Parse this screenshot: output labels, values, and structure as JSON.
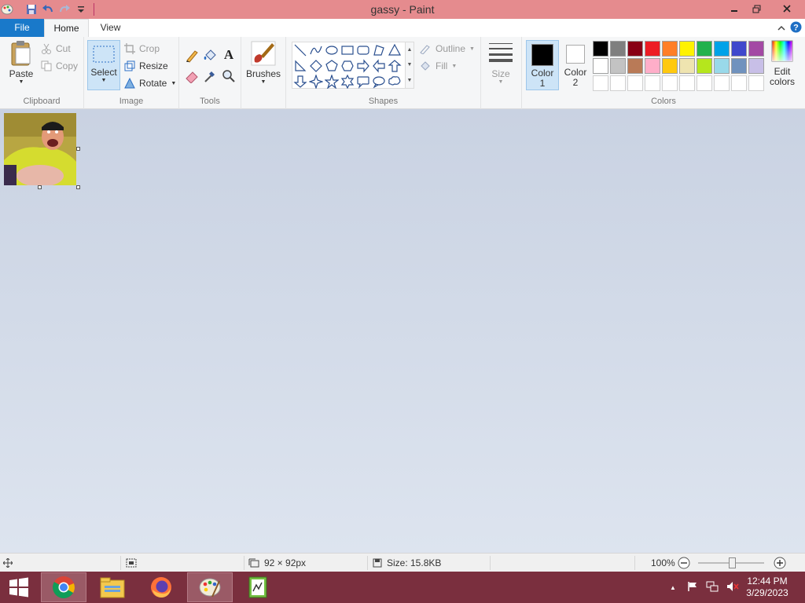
{
  "window": {
    "title": "gassy - Paint"
  },
  "qat": {
    "icons": [
      "paint-app-icon",
      "save-icon",
      "undo-icon",
      "redo-icon",
      "customize-qat-icon"
    ]
  },
  "tabs": {
    "file": "File",
    "home": "Home",
    "view": "View"
  },
  "ribbon": {
    "clipboard": {
      "label": "Clipboard",
      "paste": "Paste",
      "cut": "Cut",
      "copy": "Copy"
    },
    "image": {
      "label": "Image",
      "select": "Select",
      "crop": "Crop",
      "resize": "Resize",
      "rotate": "Rotate"
    },
    "tools": {
      "label": "Tools"
    },
    "brushes": {
      "label": "Brushes"
    },
    "shapes": {
      "label": "Shapes",
      "outline": "Outline",
      "fill": "Fill"
    },
    "size": {
      "label": "Size"
    },
    "colors": {
      "label": "Colors",
      "color1": "Color",
      "color1_num": "1",
      "color2": "Color",
      "color2_num": "2",
      "edit": "Edit",
      "edit2": "colors",
      "color1_value": "#000000",
      "color2_value": "#ffffff",
      "palette_row1": [
        "#000000",
        "#7f7f7f",
        "#880015",
        "#ed1c24",
        "#ff7f27",
        "#fff200",
        "#22b14c",
        "#00a2e8",
        "#3f48cc",
        "#a349a4"
      ],
      "palette_row2": [
        "#ffffff",
        "#c3c3c3",
        "#b97a57",
        "#ffaec9",
        "#ffc90e",
        "#efe4b0",
        "#b5e61d",
        "#99d9ea",
        "#7092be",
        "#c8bfe7"
      ],
      "palette_row3": [
        "#ffffff",
        "#ffffff",
        "#ffffff",
        "#ffffff",
        "#ffffff",
        "#ffffff",
        "#ffffff",
        "#ffffff",
        "#ffffff",
        "#ffffff"
      ]
    }
  },
  "status": {
    "dimensions": "92 × 92px",
    "size": "Size: 15.8KB",
    "zoom": "100%"
  },
  "taskbar": {
    "apps": [
      "chrome-icon",
      "file-explorer-icon",
      "firefox-icon",
      "paint-icon",
      "notepad-icon"
    ],
    "time": "12:44 PM",
    "date": "3/29/2023"
  }
}
